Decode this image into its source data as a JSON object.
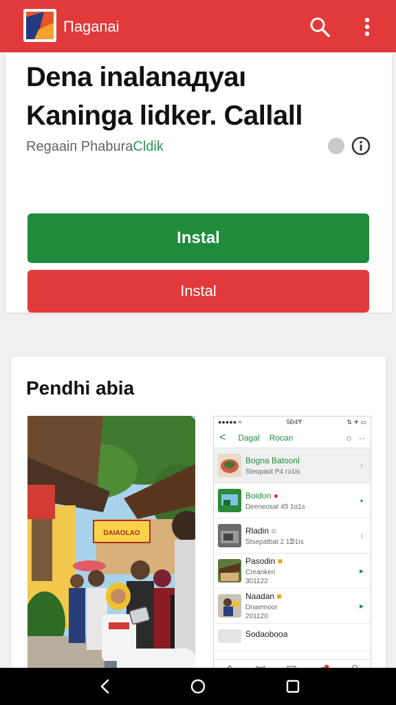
{
  "app_bar": {
    "title": "Пagaпai",
    "logo_icon": "app-logo-icon",
    "search_icon": "search-icon",
    "more_icon": "more-vert-icon",
    "color": "#e23a3a"
  },
  "hero": {
    "title_line1": "Dena inalanaдyaı",
    "title_line2": "Kaninga lidker. Callall",
    "developer_prefix": "Regaaiп Phabura",
    "developer_accent": "Cldik",
    "install_primary": "Instal",
    "install_secondary": "Instal",
    "primary_color": "#1f8c3b",
    "secondary_color": "#e23a3a"
  },
  "screenshots": {
    "title": "Pendhi abia",
    "photo_sign": "DAIAOLAO",
    "phone": {
      "status_left": "●●●●● ≈",
      "status_center": "5Ð4Ɏ",
      "status_right": "⇅ ✈ ▭",
      "header_left": "Dagal",
      "header_right": "Rocan",
      "items": [
        {
          "name": "Bogna Batoonl",
          "sub": "Steopaot P4 гэ1is",
          "badge": "",
          "name_green": true
        },
        {
          "name": "Boidon",
          "sub": "Deeneosat 45 1ɑ1s",
          "badge": "●",
          "name_green": true
        },
        {
          "name": "Rladin",
          "sub": "Stsepatbat 2 1ᕲ1is",
          "badge": "○",
          "name_green": false
        },
        {
          "name": "Pasodin",
          "sub": "Creanken",
          "sub2": "301122",
          "badge": "■",
          "name_green": false
        },
        {
          "name": "Naadan",
          "sub": "Dnaemoor",
          "sub2": "201120",
          "badge": "■",
          "name_green": false
        },
        {
          "name": "Sodaobooa",
          "sub": "",
          "badge": "",
          "name_green": false
        }
      ]
    }
  }
}
